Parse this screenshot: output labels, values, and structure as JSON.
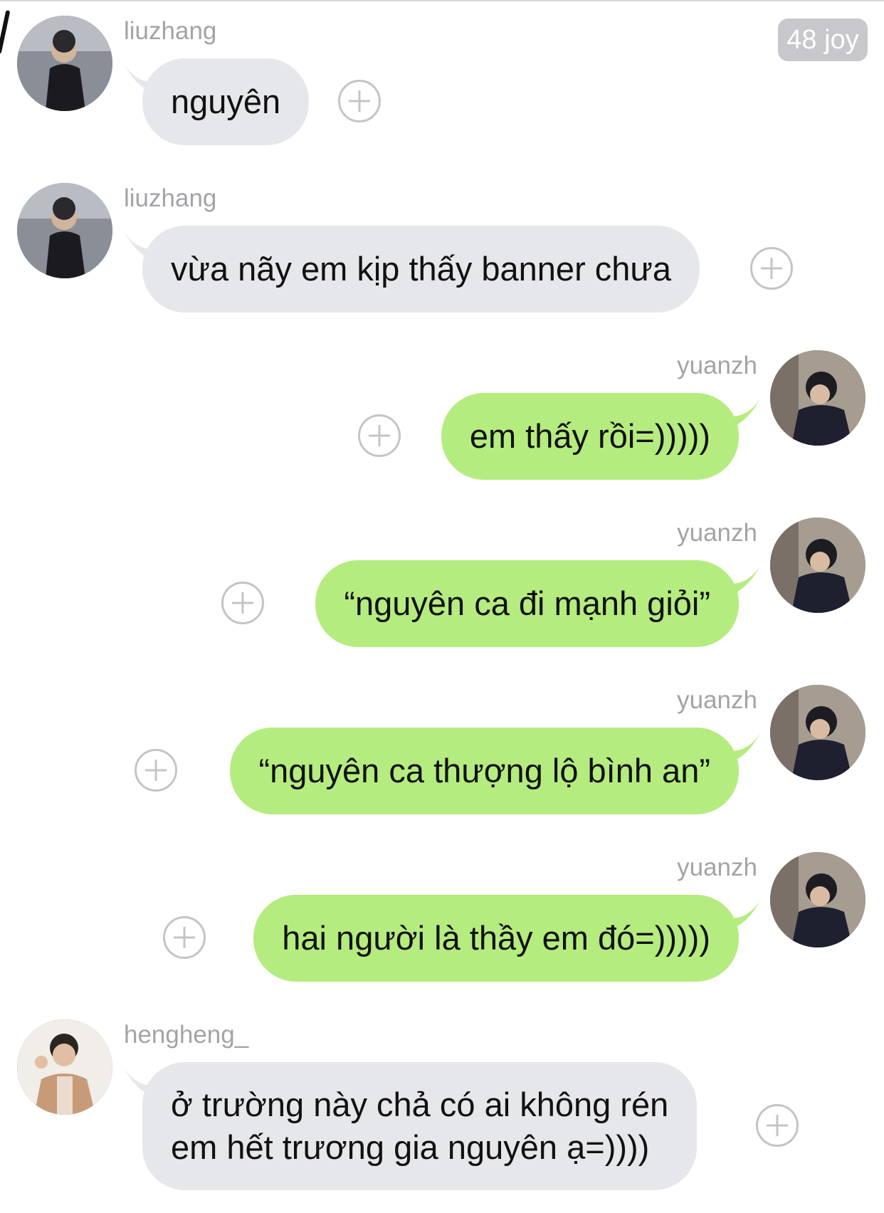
{
  "header": {
    "badge": "48 joy"
  },
  "messages": [
    {
      "sender": "liuzhang",
      "direction": "incoming",
      "text": "nguyên",
      "avatar_icon": "liuzhang-avatar"
    },
    {
      "sender": "liuzhang",
      "direction": "incoming",
      "text": "vừa nãy em kịp thấy banner chưa",
      "avatar_icon": "liuzhang-avatar"
    },
    {
      "sender": "yuanzh",
      "direction": "outgoing",
      "text": "em thấy rồi=)))))",
      "avatar_icon": "yuanzh-avatar"
    },
    {
      "sender": "yuanzh",
      "direction": "outgoing",
      "text": "“nguyên ca đi mạnh giỏi”",
      "avatar_icon": "yuanzh-avatar"
    },
    {
      "sender": "yuanzh",
      "direction": "outgoing",
      "text": "“nguyên ca thượng lộ bình an”",
      "avatar_icon": "yuanzh-avatar"
    },
    {
      "sender": "yuanzh",
      "direction": "outgoing",
      "text": "hai người là thầy em đó=)))))",
      "avatar_icon": "yuanzh-avatar"
    },
    {
      "sender": "hengheng_",
      "direction": "incoming",
      "text_lines": [
        "ở trường này chả có ai không rén",
        "em hết trương gia nguyên ạ=))))"
      ],
      "avatar_icon": "hengheng-avatar"
    }
  ],
  "colors": {
    "incoming_bubble": "#e6e7eb",
    "outgoing_bubble": "#b5ec7f",
    "name_text": "#a3a3a8",
    "badge": "#c7c7cc"
  },
  "icons": {
    "add_reaction": "plus-circle-icon"
  }
}
